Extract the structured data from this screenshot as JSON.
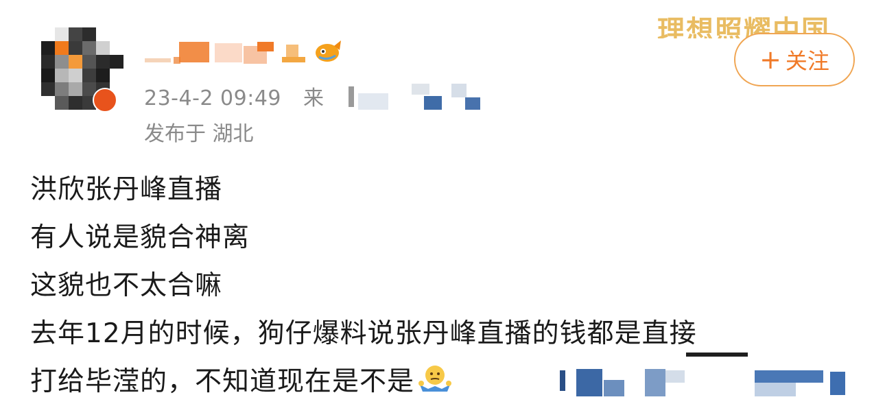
{
  "post": {
    "meta": {
      "timestamp": "23-4-2 09:49",
      "source_prefix": "来",
      "location": "发布于 湖北"
    },
    "brand": {
      "text": "理想照耀中国"
    },
    "follow_button": {
      "label": "关注",
      "icon": "plus-icon"
    },
    "body_lines": [
      "洪欣张丹峰直播",
      "有人说是貌合神离",
      "这貌也不太合嘛",
      "去年12月的时候，狗仔爆料说张丹峰直播的钱都是直接",
      "打给毕滢的，不知道现在是不是"
    ],
    "emoji": "shrug-emoji"
  },
  "colors": {
    "accent": "#f07a28",
    "meta_text": "#8a8a8a",
    "brand_gold": "#e9bc62",
    "body_text": "#1a1a1a"
  }
}
